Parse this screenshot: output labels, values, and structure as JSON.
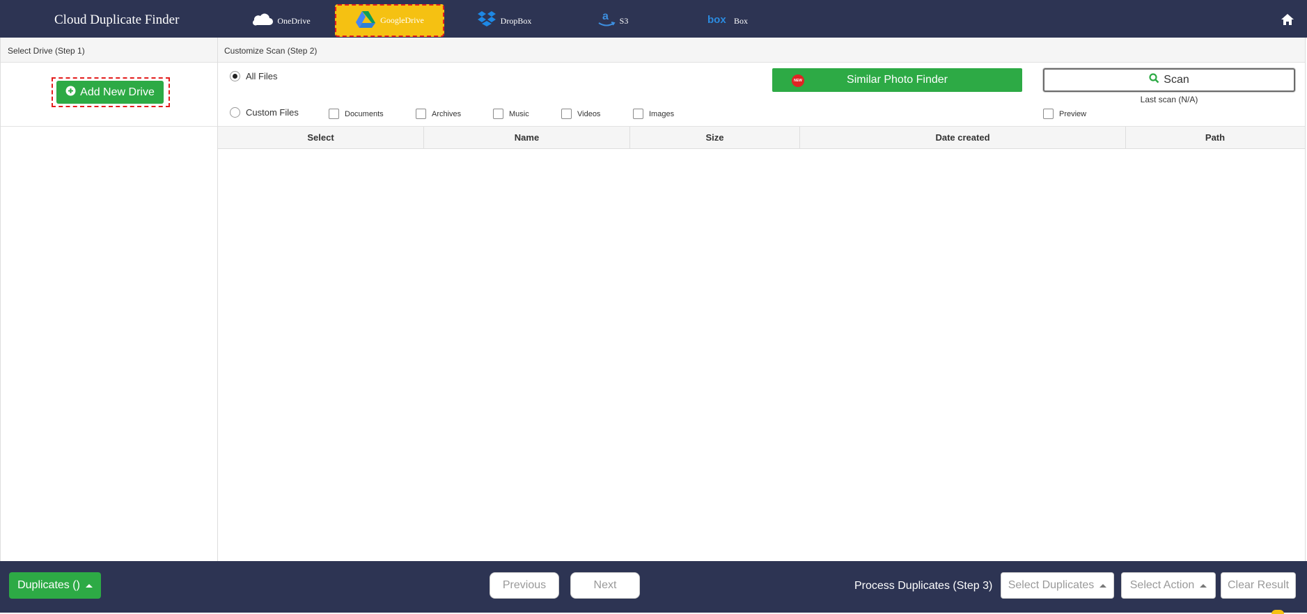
{
  "app": {
    "title": "Cloud Duplicate Finder"
  },
  "tabs": [
    {
      "label": "OneDrive",
      "icon": "onedrive-cloud-icon",
      "active": false
    },
    {
      "label": "GoogleDrive",
      "icon": "google-drive-icon",
      "active": true
    },
    {
      "label": "DropBox",
      "icon": "dropbox-icon",
      "active": false
    },
    {
      "label": "S3",
      "icon": "amazon-s3-icon",
      "active": false
    },
    {
      "label": "Box",
      "icon": "box-logo-icon",
      "active": false
    }
  ],
  "left": {
    "heading": "Select Drive (Step 1)",
    "add_drive_label": "Add New Drive"
  },
  "right": {
    "heading": "Customize Scan (Step 2)",
    "all_files_label": "All Files",
    "custom_files_label": "Custom Files",
    "file_types": [
      "Documents",
      "Archives",
      "Music",
      "Videos",
      "Images"
    ],
    "similar_photo_label": "Similar Photo Finder",
    "new_badge": "NEW",
    "scan_label": "Scan",
    "last_scan": "Last scan (N/A)",
    "preview_label": "Preview"
  },
  "table": {
    "columns": [
      "Select",
      "Name",
      "Size",
      "Date created",
      "Path"
    ],
    "rows": []
  },
  "bottom": {
    "duplicates_label": "Duplicates ()",
    "previous_label": "Previous",
    "next_label": "Next",
    "process_label": "Process Duplicates (Step 3)",
    "select_duplicates_label": "Select Duplicates",
    "select_action_label": "Select Action",
    "clear_result_label": "Clear Result"
  },
  "colors": {
    "bar": "#2d3453",
    "accent_green": "#2daa45",
    "active_tab": "#f5c112",
    "highlight_dash": "#e31d1d"
  }
}
